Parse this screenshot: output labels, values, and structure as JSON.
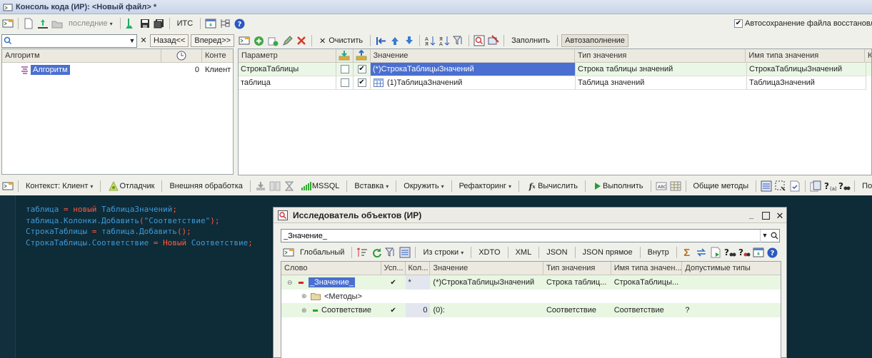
{
  "window": {
    "title": "Консоль кода (ИР): <Новый файл> *"
  },
  "topbar": {
    "recent_label": "последние",
    "its_label": "ИТС",
    "autosave_label": "Автосохранение файла восстановл",
    "autosave_checked": true
  },
  "leftbar": {
    "search_value": "",
    "back_label": "Назад<<",
    "forward_label": "Вперед>>"
  },
  "params_toolbar": {
    "clear_label": "Очистить",
    "fill_label": "Заполнить",
    "autofill_label": "Автозаполнение"
  },
  "algo_table": {
    "columns": [
      "Алгоритм",
      "Конте"
    ],
    "rows": [
      {
        "name": "Алгоритм",
        "count": "0",
        "context": "Клиент"
      }
    ]
  },
  "params_table": {
    "columns": [
      "Параметр",
      "Значение",
      "Тип значения",
      "Имя типа значения",
      "К"
    ],
    "rows": [
      {
        "param": "СтрокаТаблицы",
        "in": false,
        "out": true,
        "value": "(*)СтрокаТаблицыЗначений",
        "type": "Строка таблицы значений",
        "type_name": "СтрокаТаблицыЗначений"
      },
      {
        "param": "таблица",
        "in": false,
        "out": true,
        "value": "(1)ТаблицаЗначений",
        "type": "Таблица значений",
        "type_name": "ТаблицаЗначений"
      }
    ]
  },
  "code_toolbar": {
    "context_label": "Контекст: Клиент",
    "debugger_label": "Отладчик",
    "external_label": "Внешняя обработка",
    "mssql_label": "MSSQL",
    "insert_label": "Вставка",
    "wrap_label": "Окружить",
    "refactor_label": "Рефакторинг",
    "calc_label": "Вычислить",
    "run_label": "Выполнить",
    "common_label": "Общие методы",
    "hint_label": "Подсказка"
  },
  "code": {
    "lines": [
      [
        {
          "t": "таблица",
          "c": "id"
        },
        {
          "t": " = ",
          "c": "kw"
        },
        {
          "t": "новый",
          "c": "kw"
        },
        {
          "t": " ТаблицаЗначений",
          "c": "id"
        },
        {
          "t": ";",
          "c": "kw"
        }
      ],
      [
        {
          "t": "таблица.Колонки.Добавить",
          "c": "id"
        },
        {
          "t": "(",
          "c": "kw"
        },
        {
          "t": "\"Соответствие\"",
          "c": "str"
        },
        {
          "t": ");",
          "c": "kw"
        }
      ],
      [
        {
          "t": "СтрокаТаблицы",
          "c": "id"
        },
        {
          "t": " = ",
          "c": "kw"
        },
        {
          "t": "таблица.Добавить",
          "c": "id"
        },
        {
          "t": "();",
          "c": "kw"
        }
      ],
      [
        {
          "t": "СтрокаТаблицы.Соответствие",
          "c": "id"
        },
        {
          "t": " = ",
          "c": "kw"
        },
        {
          "t": "Новый",
          "c": "kw"
        },
        {
          "t": " Соответствие",
          "c": "id"
        },
        {
          "t": ";",
          "c": "kw"
        }
      ]
    ]
  },
  "explorer": {
    "title": "Исследователь объектов (ИР)",
    "input_value": "_Значение_",
    "toolbar": {
      "global_label": "Глобальный",
      "from_string_label": "Из строки",
      "xdto_label": "XDTO",
      "xml_label": "XML",
      "json_label": "JSON",
      "json_direct_label": "JSON прямое",
      "inside_label": "Внутр"
    },
    "columns": [
      "Слово",
      "Усп...",
      "Кол...",
      "Значение",
      "Тип значения",
      "Имя типа значен...",
      "Допустимые типы"
    ],
    "rows": [
      {
        "word": "_Значение_",
        "ok": "✔",
        "count": "*",
        "value": "(*)СтрокаТаблицыЗначений",
        "type": "Строка таблиц...",
        "type_name": "СтрокаТаблицы...",
        "allowed": ""
      },
      {
        "word": "<Методы>",
        "ok": "",
        "count": "",
        "value": "",
        "type": "",
        "type_name": "",
        "allowed": ""
      },
      {
        "word": "Соответствие",
        "ok": "✔",
        "count": "0",
        "value": "(0):",
        "type": "Соответствие",
        "type_name": "Соответствие",
        "allowed": "?"
      }
    ]
  },
  "colors": {
    "accent": "#4a6fd0",
    "selection": "#3e5fc4",
    "code_bg": "#0e2b38",
    "green_row": "#e8f6e2"
  }
}
